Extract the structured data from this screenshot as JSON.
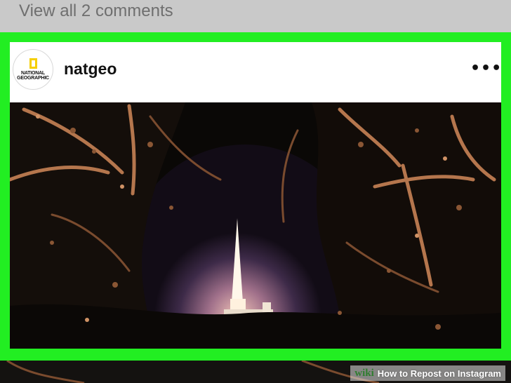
{
  "comments": {
    "link_text": "View all 2 comments"
  },
  "post": {
    "username": "natgeo",
    "avatar": {
      "logo_line1": "NATIONAL",
      "logo_line2": "GEOGRAPHIC"
    },
    "more_icon": "more-horizontal-icon",
    "more_glyph": "•••",
    "image_subject": "illuminated cathedral spire at night framed by lit trees"
  },
  "watermark": {
    "wiki": "wiki",
    "title": "How to Repost on Instagram"
  },
  "colors": {
    "highlight": "#22ee22",
    "header_bg": "#ffffff",
    "comments_bg": "#c9c9c9",
    "logo_yellow": "#f5cf00"
  }
}
